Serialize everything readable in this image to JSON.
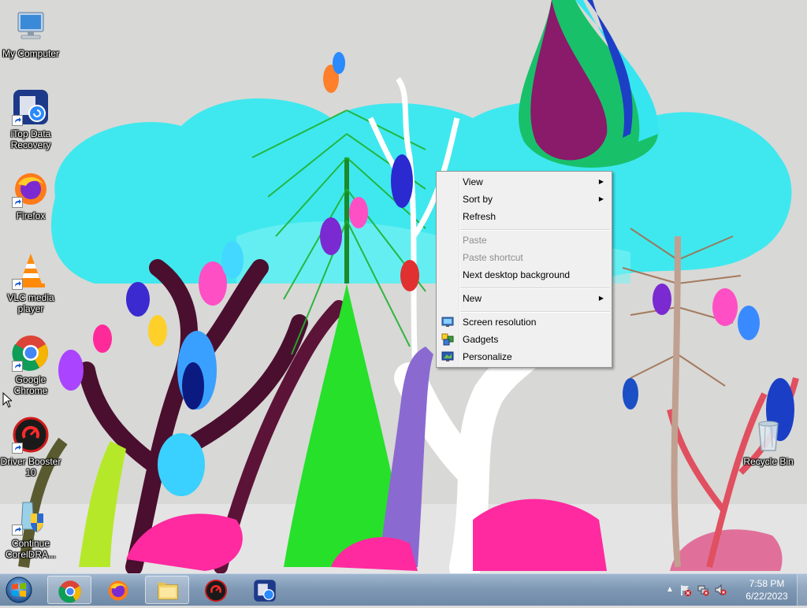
{
  "desktop": {
    "icons": [
      {
        "label": "My Computer"
      },
      {
        "label": "iTop Data Recovery"
      },
      {
        "label": "Firefox"
      },
      {
        "label": "VLC media player"
      },
      {
        "label": "Google Chrome"
      },
      {
        "label": "Driver Booster 10"
      },
      {
        "label": "Continue CorelDRA..."
      },
      {
        "label": "Recycle Bin"
      }
    ]
  },
  "context_menu": {
    "items": [
      {
        "label": "View",
        "submenu": true
      },
      {
        "label": "Sort by",
        "submenu": true
      },
      {
        "label": "Refresh"
      },
      {
        "label": "Paste",
        "disabled": true
      },
      {
        "label": "Paste shortcut",
        "disabled": true
      },
      {
        "label": "Next desktop background"
      },
      {
        "label": "New",
        "submenu": true
      },
      {
        "label": "Screen resolution",
        "icon": "monitor-icon"
      },
      {
        "label": "Gadgets",
        "icon": "gadgets-icon"
      },
      {
        "label": "Personalize",
        "icon": "personalize-icon"
      }
    ]
  },
  "taskbar": {
    "pinned": [
      "chrome-icon",
      "firefox-icon",
      "file-explorer-icon",
      "driver-booster-icon",
      "itop-data-recovery-icon"
    ],
    "clock": {
      "time": "7:58 PM",
      "date": "6/22/2023"
    }
  },
  "colors": {
    "accent": "#3b6ea5",
    "taskbar": "#7f99b5"
  }
}
